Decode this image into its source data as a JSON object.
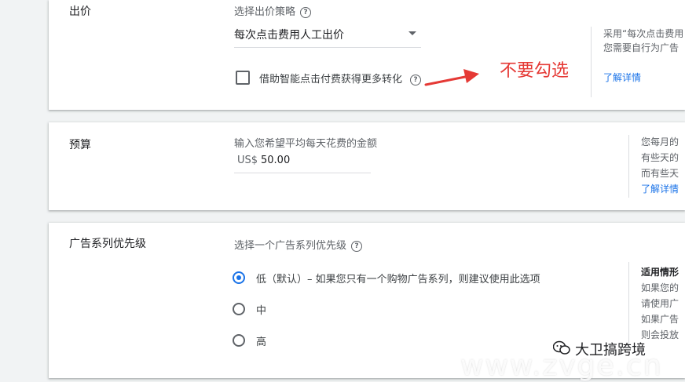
{
  "bidding": {
    "title": "出价",
    "strategy_hint": "选择出价策略",
    "strategy_value": "每次点击费用人工出价",
    "checkbox_label": "借助智能点击付费获得更多转化",
    "annotation": "不要勾选",
    "side_text_1": "采用“每次点击费用",
    "side_text_2": "您需要自行为广告",
    "learn_more": "了解详情"
  },
  "budget": {
    "title": "预算",
    "hint": "输入您希望平均每天花费的金额",
    "currency": "US$",
    "amount": "50.00",
    "side_text_1": "您每月的",
    "side_text_2": "有些天的",
    "side_text_3": "而有些天",
    "learn_more": "了解详情"
  },
  "priority": {
    "title": "广告系列优先级",
    "hint": "选择一个广告系列优先级",
    "options": [
      {
        "label": "低（默认）– 如果您只有一个购物广告系列，则建议使用此选项",
        "checked": true
      },
      {
        "label": "中",
        "checked": false
      },
      {
        "label": "高",
        "checked": false
      }
    ],
    "side_title": "适用情形",
    "side_text_1": "如果您的",
    "side_text_2": "请使用广",
    "side_text_3": "如果广告",
    "side_text_4": "则会投放"
  },
  "watermark": {
    "site": "www.zvge.cn",
    "brand": "大卫搞跨境"
  },
  "colors": {
    "accent": "#1a73e8",
    "annotation": "#e53935"
  }
}
